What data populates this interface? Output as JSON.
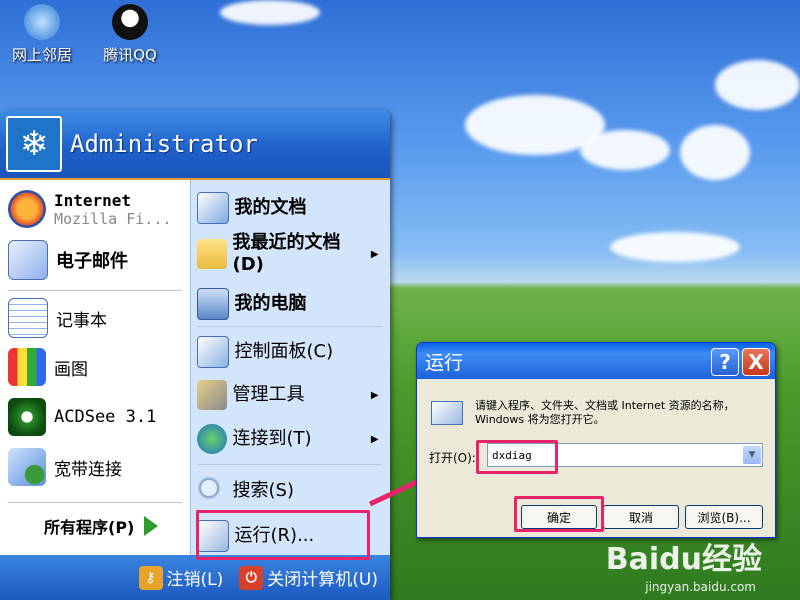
{
  "desktop": {
    "icons": [
      {
        "label": "网上邻居",
        "name": "network-neighborhood"
      },
      {
        "label": "腾讯QQ",
        "name": "tencent-qq"
      }
    ]
  },
  "start_menu": {
    "user": "Administrator",
    "left_items": [
      {
        "title": "Internet",
        "subtitle": "Mozilla Fi..."
      },
      {
        "title": "电子邮件"
      },
      {
        "title": "记事本"
      },
      {
        "title": "画图"
      },
      {
        "title": "ACDSee 3.1"
      },
      {
        "title": "宽带连接"
      }
    ],
    "all_programs": "所有程序(P)",
    "right_items": [
      {
        "label": "我的文档"
      },
      {
        "label": "我最近的文档",
        "label2": "(D)"
      },
      {
        "label": "我的电脑"
      },
      {
        "label": "控制面板(C)"
      },
      {
        "label": "管理工具"
      },
      {
        "label": "连接到(T)"
      },
      {
        "label": "搜索(S)"
      },
      {
        "label": "运行(R)..."
      }
    ],
    "footer": {
      "logoff": "注销(L)",
      "shutdown": "关闭计算机(U)"
    }
  },
  "run_dialog": {
    "title": "运行",
    "help": "?",
    "close": "X",
    "description": "请键入程序、文件夹、文档或 Internet 资源的名称，Windows 将为您打开它。",
    "open_label": "打开(O):",
    "input_value": "dxdiag",
    "buttons": {
      "ok": "确定",
      "cancel": "取消",
      "browse": "浏览(B)..."
    }
  },
  "watermark": {
    "logo": "Baidu经验",
    "url": "jingyan.baidu.com"
  },
  "colors": {
    "highlight": "#e8236a",
    "xp_blue": "#1e5fc8",
    "menu_right_bg": "#d3e5fa"
  }
}
